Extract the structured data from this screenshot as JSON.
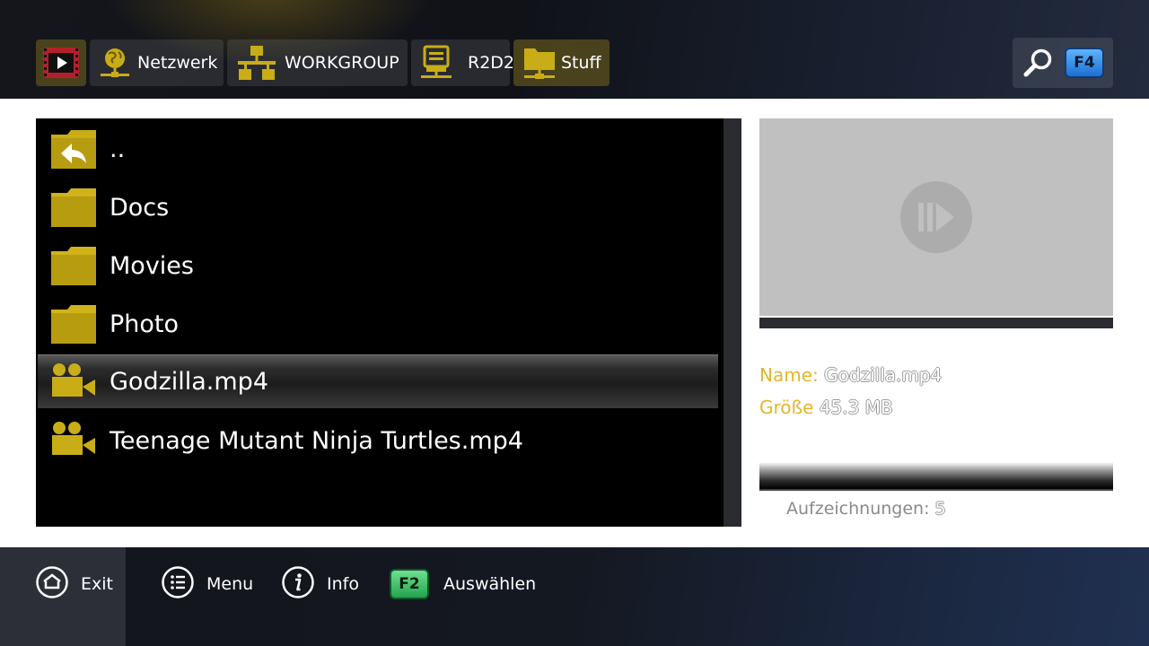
{
  "header": {
    "breadcrumbs": [
      {
        "label": "",
        "icon": "film-play-icon"
      },
      {
        "label": "Netzwerk",
        "icon": "globe-network-icon"
      },
      {
        "label": "WORKGROUP",
        "icon": "network-topology-icon"
      },
      {
        "label": "R2D2",
        "icon": "computer-icon"
      },
      {
        "label": "Stuff",
        "icon": "shared-folder-icon"
      }
    ],
    "search_icon": "search-icon",
    "search_key": "F4"
  },
  "files": [
    {
      "name": "..",
      "type": "parent",
      "icon": "folder-back-icon"
    },
    {
      "name": "Docs",
      "type": "folder",
      "icon": "folder-icon"
    },
    {
      "name": "Movies",
      "type": "folder",
      "icon": "folder-icon"
    },
    {
      "name": "Photo",
      "type": "folder",
      "icon": "folder-icon"
    },
    {
      "name": "Godzilla.mp4",
      "type": "video",
      "icon": "video-camera-icon",
      "selected": true
    },
    {
      "name": "Teenage Mutant Ninja Turtles.mp4",
      "type": "video",
      "icon": "video-camera-icon"
    }
  ],
  "details": {
    "name_label": "Name:",
    "name_value": "Godzilla.mp4",
    "size_label": "Größe",
    "size_value": "45.3 MB",
    "recordings_label": "Aufzeichnungen:",
    "recordings_value": "5"
  },
  "footer": {
    "exit_label": "Exit",
    "menu_label": "Menu",
    "info_label": "Info",
    "select_key": "F2",
    "select_label": "Auswählen"
  },
  "colors": {
    "accent_gold": "#e4b52a",
    "folder_yellow": "#c9ad16",
    "f4_blue": "#2a86e6",
    "f2_green": "#39c062"
  }
}
